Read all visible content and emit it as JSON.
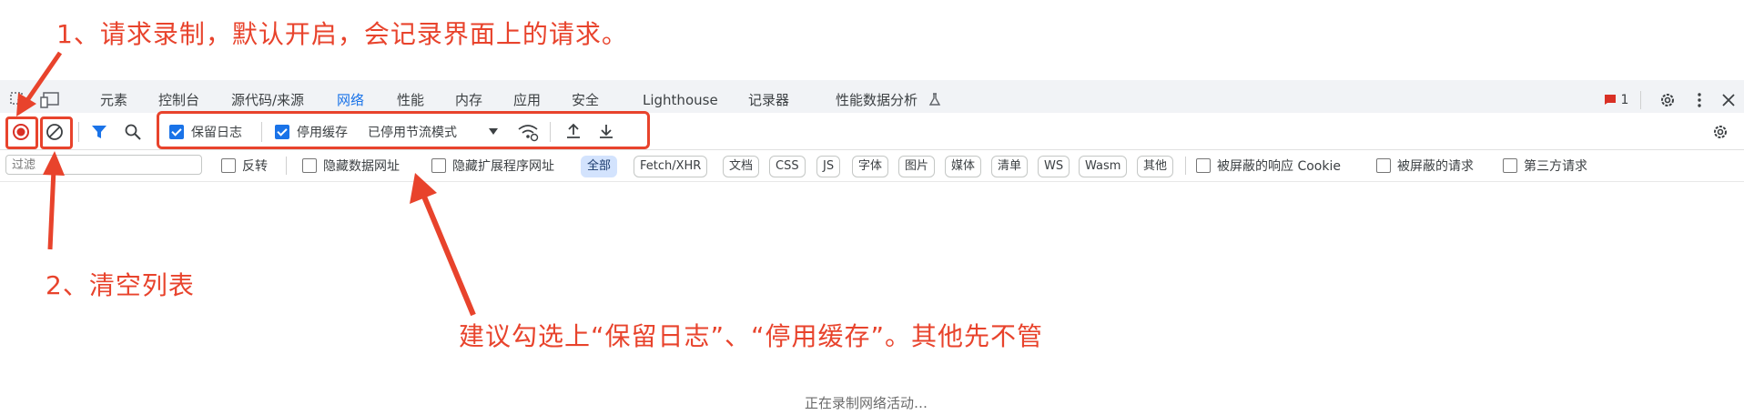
{
  "annotations": {
    "note1": "1、请求录制，默认开启，会记录界面上的请求。",
    "note2": "2、清空列表",
    "note3": "建议勾选上“保留日志”、“停用缓存”。其他先不管"
  },
  "tabs": [
    {
      "label": "元素"
    },
    {
      "label": "控制台"
    },
    {
      "label": "源代码/来源"
    },
    {
      "label": "网络"
    },
    {
      "label": "性能"
    },
    {
      "label": "内存"
    },
    {
      "label": "应用"
    },
    {
      "label": "安全"
    },
    {
      "label": "Lighthouse"
    },
    {
      "label": "记录器"
    },
    {
      "label": "性能数据分析"
    }
  ],
  "issues_count": "1",
  "toolbar": {
    "preserve_log": {
      "label": "保留日志",
      "checked": true
    },
    "disable_cache": {
      "label": "停用缓存",
      "checked": true
    },
    "throttling": "已停用节流模式"
  },
  "filter": {
    "placeholder": "过滤",
    "invert": "反转",
    "hide_data_urls": "隐藏数据网址",
    "hide_extension_urls": "隐藏扩展程序网址",
    "chips": [
      "全部",
      "Fetch/XHR",
      "文档",
      "CSS",
      "JS",
      "字体",
      "图片",
      "媒体",
      "清单",
      "WS",
      "Wasm",
      "其他"
    ],
    "blocked_cookies": "被屏蔽的响应 Cookie",
    "blocked_requests": "被屏蔽的请求",
    "third_party": "第三方请求"
  },
  "status_text": "正在录制网络活动…",
  "colors": {
    "accent": "#1a73e8",
    "annotation": "#e8432c"
  }
}
